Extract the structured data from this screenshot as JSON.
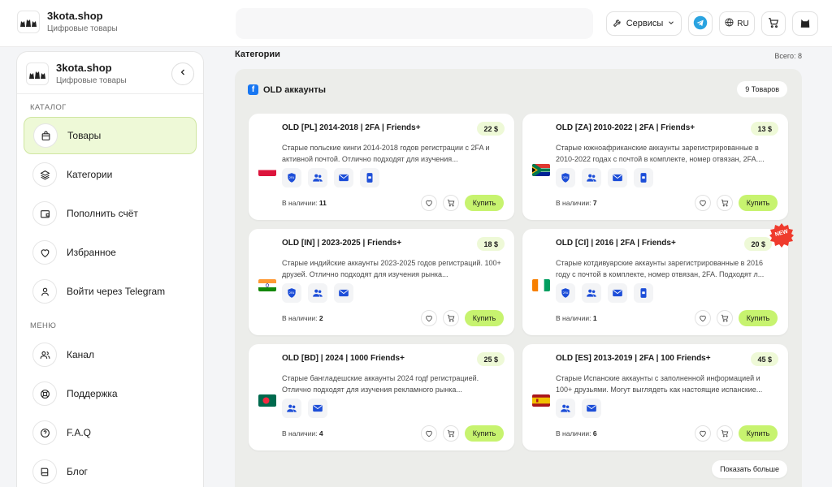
{
  "header": {
    "brand_name": "3kota.shop",
    "brand_sub": "Цифровые товары",
    "services_label": "Сервисы",
    "lang_label": "RU",
    "icons": [
      "logo-cats",
      "wrench-icon",
      "chevron-down-icon",
      "telegram-icon",
      "globe-icon",
      "cart-icon",
      "avatar-cat-icon"
    ]
  },
  "sidebar": {
    "brand_name": "3kota.shop",
    "brand_sub": "Цифровые товары",
    "section_catalog": "КАТАЛОГ",
    "section_menu": "МЕНЮ",
    "catalog_items": [
      {
        "label": "Товары",
        "icon": "bag-icon",
        "active": true
      },
      {
        "label": "Категории",
        "icon": "layers-icon"
      },
      {
        "label": "Пополнить счёт",
        "icon": "wallet-icon"
      },
      {
        "label": "Избранное",
        "icon": "heart-icon"
      },
      {
        "label": "Войти через Telegram",
        "icon": "user-icon"
      }
    ],
    "menu_items": [
      {
        "label": "Канал",
        "icon": "users-icon"
      },
      {
        "label": "Поддержка",
        "icon": "lifebuoy-icon"
      },
      {
        "label": "F.A.Q",
        "icon": "question-icon"
      },
      {
        "label": "Блог",
        "icon": "book-icon"
      }
    ]
  },
  "main": {
    "title": "Категории",
    "total": "Всего: 8",
    "panel": {
      "title": "OLD аккаунты",
      "count_badge": "9 Товаров",
      "show_more": "Показать больше",
      "stock_label": "В наличии:",
      "buy_label": "Купить",
      "new_label": "NEW",
      "cards": [
        {
          "title": "OLD [PL] 2014-2018 | 2FA | Friends+",
          "price": "22 $",
          "desc": "Старые польские кинги 2014-2018 годов регистрации с 2FA и активной почтой. Отлично подходят для изучения...",
          "flag": "pl",
          "features": [
            "2fa",
            "friends",
            "mail",
            "phone"
          ],
          "stock": "11"
        },
        {
          "title": "OLD [ZA] 2010-2022 | 2FA | Friends+",
          "price": "13 $",
          "desc": "Старые южноафриканские аккаунты зарегистрированные в 2010-2022 годах с почтой в комплекте, номер отвязан, 2FA....",
          "flag": "za",
          "features": [
            "2fa",
            "friends",
            "mail",
            "phone"
          ],
          "stock": "7"
        },
        {
          "title": "OLD [IN] | 2023-2025 | Friends+",
          "price": "18 $",
          "desc": "Старые индийские аккаунты 2023-2025 годов регистраций. 100+ друзей. Отлично подходят для изучения рынка...",
          "flag": "in",
          "features": [
            "2fa",
            "friends",
            "mail"
          ],
          "stock": "2"
        },
        {
          "title": "OLD [CI] | 2016 | 2FA | Friends+",
          "price": "20 $",
          "desc": "Старые котдивуарские аккаунты зарегистрированные в 2016 году с почтой в комплекте, номер отвязан, 2FA. Подходят л...",
          "flag": "ci",
          "features": [
            "2fa",
            "friends",
            "mail",
            "phone"
          ],
          "stock": "1",
          "is_new": true
        },
        {
          "title": "OLD [BD] | 2024 | 1000 Friends+",
          "price": "25 $",
          "desc": "Старые бангладешские аккаунты 2024 годf регистрацией. Отлично подходят для изучения рекламного рынка...",
          "flag": "bd",
          "features": [
            "friends",
            "mail"
          ],
          "stock": "4"
        },
        {
          "title": "OLD [ES] 2013-2019 | 2FA | 100 Friends+",
          "price": "45 $",
          "desc": "Старые Испанские аккаунты с заполненной информацией и 100+ друзьями. Могут выглядеть как настоящие испанские...",
          "flag": "es",
          "features": [
            "friends",
            "mail"
          ],
          "stock": "6"
        }
      ]
    }
  },
  "colors": {
    "accent_green": "#c7f36f",
    "price_bg": "#eef9d7",
    "feature_blue": "#1d4ed8",
    "new_red": "#ef3b2d",
    "facebook_blue": "#1877f2",
    "telegram_blue": "#2aa3e0"
  }
}
